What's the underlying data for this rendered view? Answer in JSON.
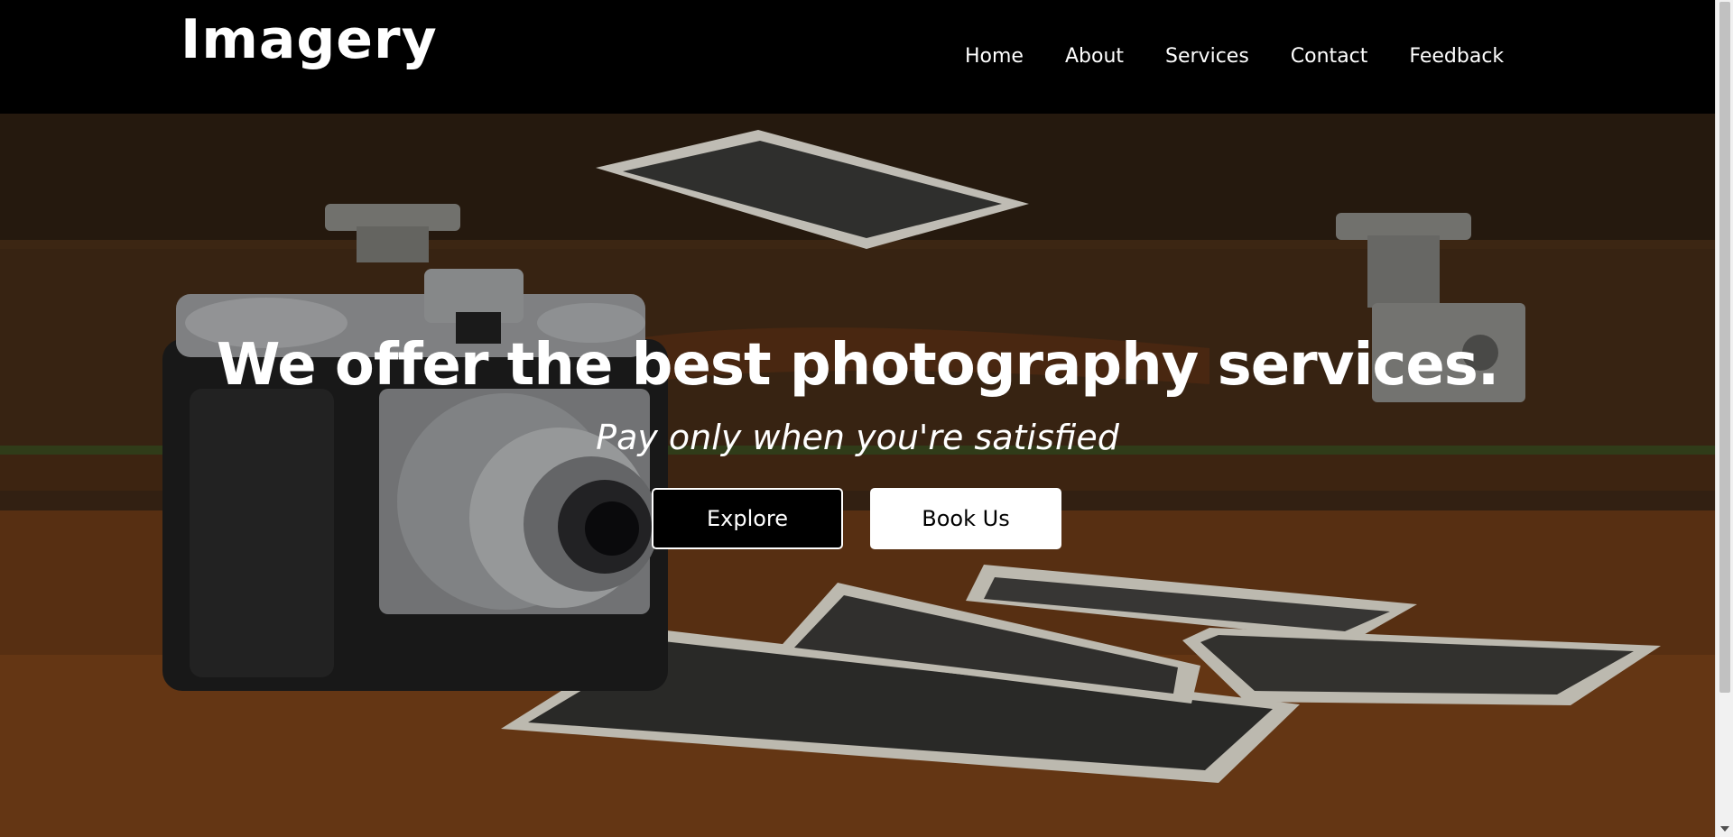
{
  "header": {
    "logo": "Imagery",
    "nav": [
      "Home",
      "About",
      "Services",
      "Contact",
      "Feedback"
    ]
  },
  "hero": {
    "title": "We offer the best photography services.",
    "subtitle": "Pay only when you're satisfied",
    "buttons": {
      "explore": "Explore",
      "book": "Book Us"
    },
    "background": "vintage camera with old photographs on a leather suitcase"
  },
  "colors": {
    "header_bg": "#000000",
    "text": "#ffffff",
    "explore_bg": "#000000",
    "book_bg": "#ffffff"
  }
}
